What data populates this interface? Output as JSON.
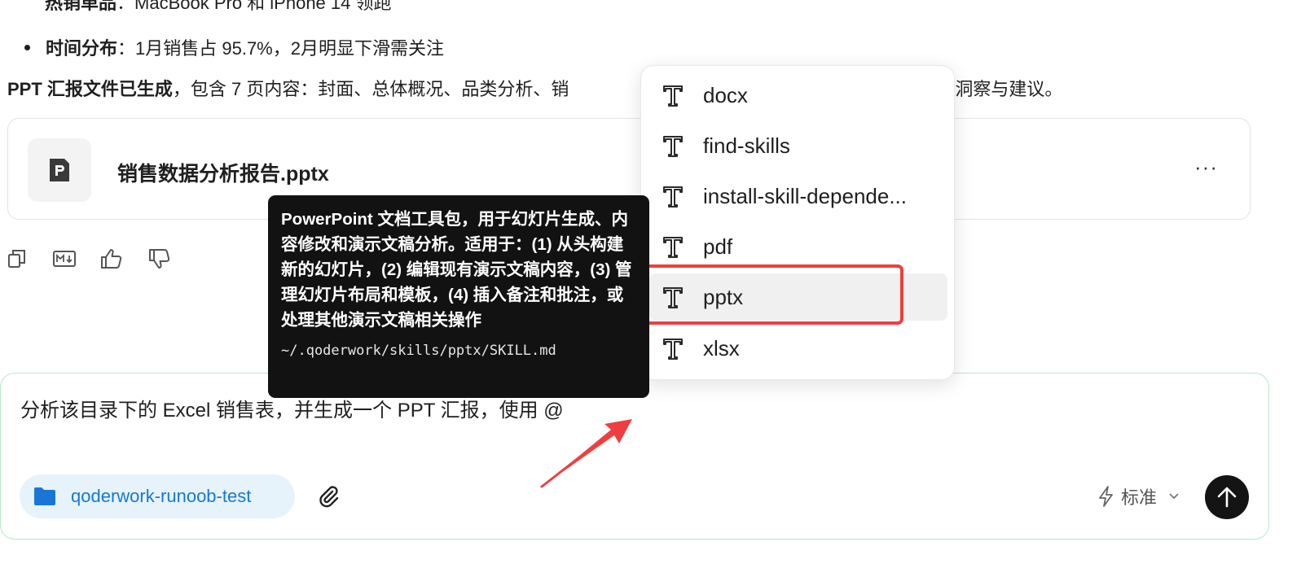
{
  "message": {
    "partial_bullet": {
      "label": "热销单品",
      "text": "：MacBook Pro 和 iPhone 14 领跑"
    },
    "bullet": {
      "label": "时间分布",
      "text": "：1月销售占 95.7%，2月明显下滑需关注"
    },
    "summary": {
      "bold": "PPT 汇报文件已生成",
      "pre": "，包含 7 页内容：封面、总体概况、品类分析、销",
      "post": "势以及关键洞察与建议。"
    }
  },
  "file_card": {
    "name": "销售数据分析报告.pptx",
    "more": "···",
    "icon": "pptx-file-icon"
  },
  "actions": [
    {
      "name": "copy-icon"
    },
    {
      "name": "markdown-icon"
    },
    {
      "name": "thumbs-up-icon"
    },
    {
      "name": "thumbs-down-icon"
    }
  ],
  "tooltip": {
    "description": "PowerPoint 文档工具包，用于幻灯片生成、内容修改和演示文稿分析。适用于：(1) 从头构建新的幻灯片，(2) 编辑现有演示文稿内容，(3) 管理幻灯片布局和模板，(4) 插入备注和批注，或处理其他演示文稿相关操作",
    "path": "~/.qoderwork/skills/pptx/SKILL.md"
  },
  "skills_menu": {
    "items": [
      {
        "label": "docx",
        "icon": "skill-icon"
      },
      {
        "label": "find-skills",
        "icon": "skill-icon"
      },
      {
        "label": "install-skill-depende...",
        "icon": "skill-icon"
      },
      {
        "label": "pdf",
        "icon": "skill-icon"
      },
      {
        "label": "pptx",
        "icon": "skill-icon",
        "selected": true
      },
      {
        "label": "xlsx",
        "icon": "skill-icon"
      }
    ]
  },
  "composer": {
    "text": "分析该目录下的 Excel 销售表，并生成一个 PPT 汇报，使用 @",
    "folder_chip": "qoderwork-runoob-test",
    "mode": "标准"
  },
  "colors": {
    "highlight": "#ef3e3e",
    "chip_bg": "#e6f3fb",
    "chip_text": "#1877d6",
    "input_border": "#b9e7cb",
    "tooltip_bg": "#121212"
  }
}
